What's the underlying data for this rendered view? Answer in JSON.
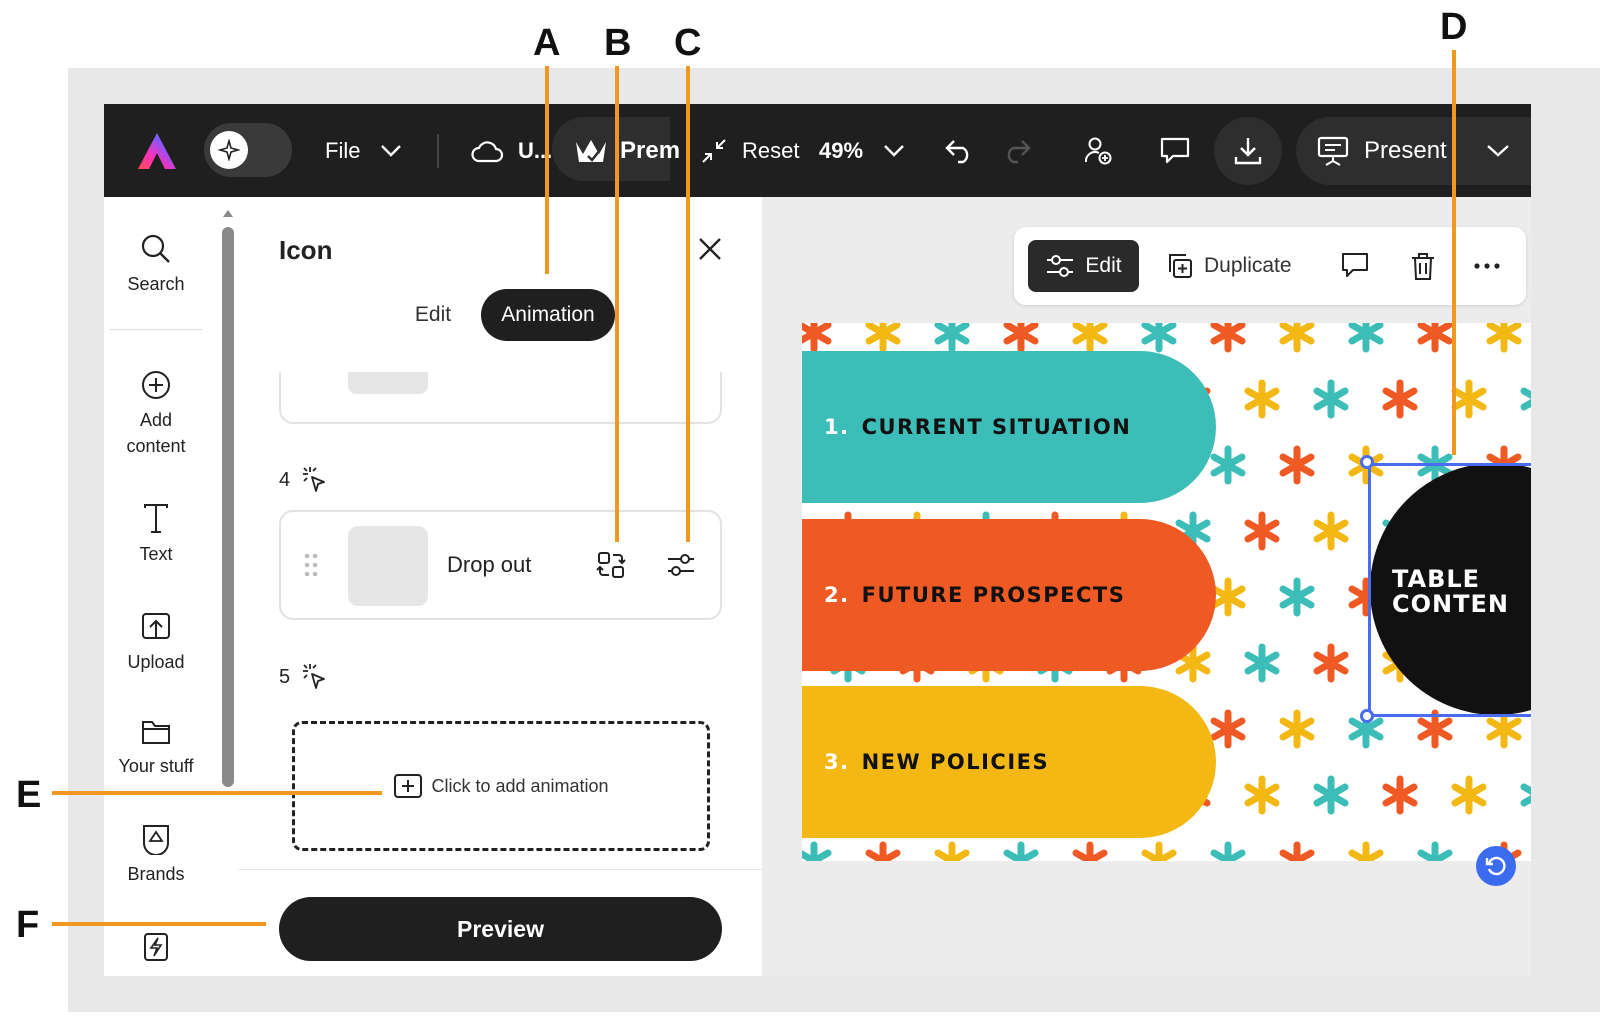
{
  "callouts": {
    "a": "A",
    "b": "B",
    "c": "C",
    "d": "D",
    "e": "E",
    "f": "F"
  },
  "toolbar": {
    "file_label": "File",
    "upload_label": "U...",
    "premium_label": "Prem",
    "reset_label": "Reset",
    "zoom_value": "49%",
    "present_label": "Present"
  },
  "rail": {
    "items": [
      {
        "label": "Search",
        "icon": "search-icon"
      },
      {
        "label": "Add content",
        "icon": "plus-circle-icon"
      },
      {
        "label": "Text",
        "icon": "text-icon"
      },
      {
        "label": "Upload",
        "icon": "upload-icon"
      },
      {
        "label": "Your stuff",
        "icon": "folder-icon"
      },
      {
        "label": "Brands",
        "icon": "brand-icon"
      },
      {
        "label": "",
        "icon": "bolt-icon"
      }
    ]
  },
  "panel": {
    "title": "Icon",
    "tabs": {
      "edit": "Edit",
      "animation": "Animation"
    },
    "step4": "4",
    "step5": "5",
    "animation_name": "Drop out",
    "add_animation": "Click to add animation",
    "preview": "Preview"
  },
  "context_bar": {
    "edit": "Edit",
    "duplicate": "Duplicate"
  },
  "slide": {
    "items": [
      {
        "num": "1.",
        "label": "CURRENT SITUATION"
      },
      {
        "num": "2.",
        "label": "FUTURE PROSPECTS"
      },
      {
        "num": "3.",
        "label": "NEW POLICIES"
      }
    ],
    "circle_line1": "TABLE",
    "circle_line2": "CONTEN"
  },
  "colors": {
    "accent_callout": "#f0981f",
    "teal": "#3dbdb8",
    "orange": "#ef5a24",
    "yellow": "#f3b814",
    "selection": "#4a6cf0"
  }
}
